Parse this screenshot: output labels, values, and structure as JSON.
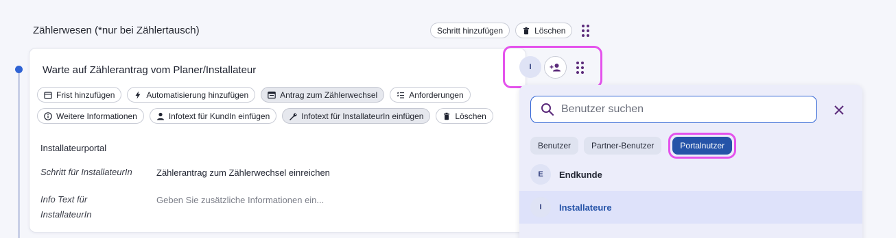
{
  "section": {
    "title": "Zählerwesen (*nur bei Zählertausch)",
    "add_step_label": "Schritt hinzufügen",
    "delete_label": "Löschen"
  },
  "card": {
    "title": "Warte auf Zählerantrag vom Planer/Installateur",
    "chips_row1": [
      "Frist hinzufügen",
      "Automatisierung hinzufügen",
      "Antrag zum Zählerwechsel",
      "Anforderungen"
    ],
    "chips_row2": [
      "Weitere Informationen",
      "Infotext für KundIn einfügen",
      "Infotext für InstallateurIn einfügen",
      "Löschen"
    ],
    "portal_heading": "Installateurportal",
    "step_label": "Schritt für InstallateurIn",
    "step_value": "Zählerantrag zum Zählerwechsel einreichen",
    "info_label_1": "Info Text für",
    "info_label_2": "InstallateurIn",
    "info_placeholder": "Geben Sie zusätzliche Informationen ein...",
    "assignee_initial": "I"
  },
  "dropdown": {
    "search_placeholder": "Benutzer suchen",
    "filters": [
      "Benutzer",
      "Partner-Benutzer",
      "Portalnutzer"
    ],
    "active_filter": "Portalnutzer",
    "items": [
      {
        "initial": "E",
        "name": "Endkunde"
      },
      {
        "initial": "I",
        "name": "Installateure"
      }
    ]
  },
  "colors": {
    "accent": "#2553a8",
    "highlight": "#e452ec",
    "timeline_dot": "#2f63d4"
  }
}
